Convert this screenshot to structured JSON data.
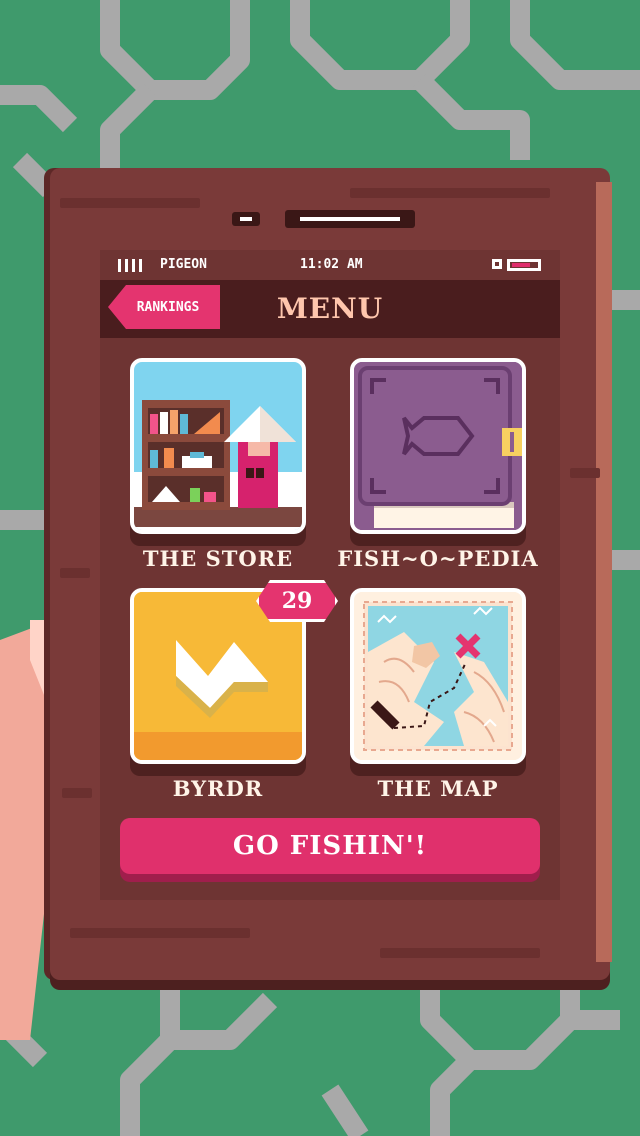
{
  "statusbar": {
    "carrier": "PIGEON",
    "time": "11:02 AM",
    "signal_icon": "signal-bars-icon",
    "battery_icon": "battery-icon"
  },
  "header": {
    "rankings_label": "RANKINGS",
    "title": "MENU"
  },
  "menu": {
    "items": [
      {
        "label": "THE STORE",
        "icon": "store-shelf-icon"
      },
      {
        "label": "FISH~O~PEDIA",
        "icon": "fish-book-icon"
      },
      {
        "label": "BYRDR",
        "icon": "byrdr-bird-icon",
        "badge": "29"
      },
      {
        "label": "THE MAP",
        "icon": "treasure-map-icon"
      }
    ]
  },
  "cta": {
    "label": "GO FISHIN'!"
  },
  "colors": {
    "background": "#3f9a6c",
    "wood": "#7a3a39",
    "accent": "#e4346f",
    "title": "#ffc6ad"
  }
}
